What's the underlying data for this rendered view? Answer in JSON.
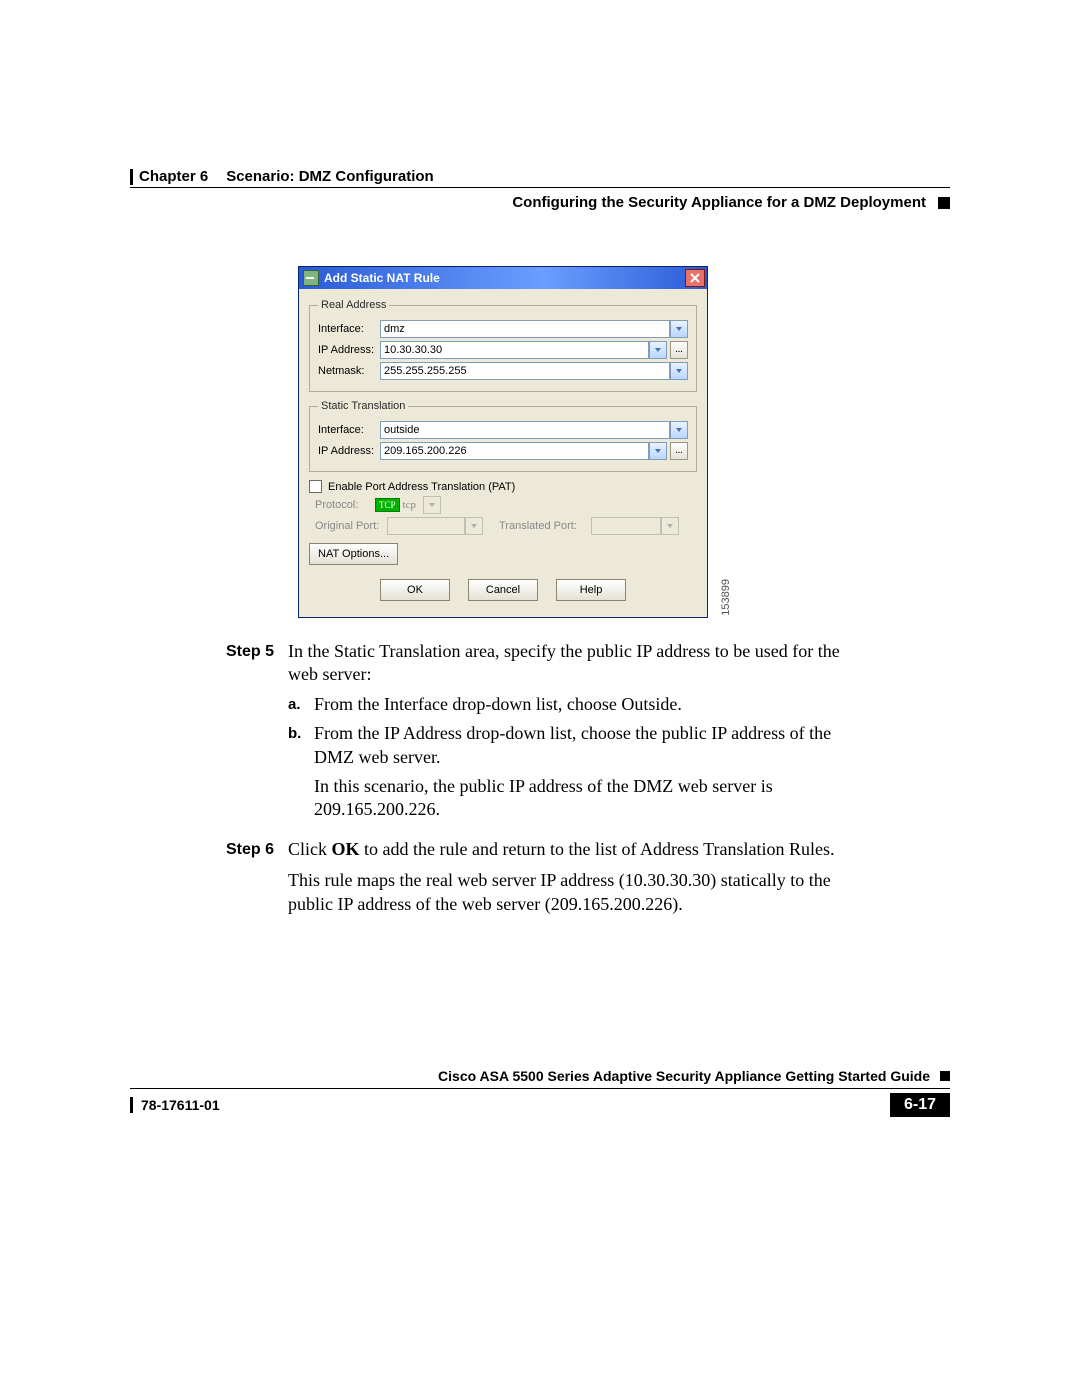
{
  "header": {
    "chapter": "Chapter 6",
    "chapter_title": "Scenario: DMZ Configuration",
    "section": "Configuring the Security Appliance for a DMZ Deployment"
  },
  "dialog": {
    "title": "Add Static NAT Rule",
    "fieldset_real": "Real Address",
    "fieldset_static": "Static Translation",
    "labels": {
      "interface": "Interface:",
      "ip": "IP Address:",
      "netmask": "Netmask:",
      "protocol": "Protocol:",
      "orig_port": "Original Port:",
      "trans_port": "Translated Port:"
    },
    "real": {
      "interface": "dmz",
      "ip": "10.30.30.30",
      "netmask": "255.255.255.255"
    },
    "static": {
      "interface": "outside",
      "ip": "209.165.200.226"
    },
    "pat": {
      "checkbox_label": "Enable Port Address Translation (PAT)",
      "protocol_badge": "TCP",
      "protocol_text": "tcp"
    },
    "buttons": {
      "nat_options": "NAT Options...",
      "ok": "OK",
      "cancel": "Cancel",
      "help": "Help"
    },
    "figure_id": "153899"
  },
  "steps": {
    "s5_label": "Step 5",
    "s5_intro": "In the Static Translation area, specify the public IP address to be used for the web server:",
    "s5a_letter": "a.",
    "s5a_text": "From the Interface drop-down list, choose Outside.",
    "s5b_letter": "b.",
    "s5b_text": "From the IP Address drop-down list, choose the public IP address of the DMZ web server.",
    "s5b_para": "In this scenario, the public IP address of the DMZ web server is 209.165.200.226.",
    "s6_label": "Step 6",
    "s6_click": "Click ",
    "s6_ok": "OK",
    "s6_rest": " to add the rule and return to the list of Address Translation Rules.",
    "s6_para": "This rule maps the real web server IP address (10.30.30.30) statically to the public IP address of the web server (209.165.200.226)."
  },
  "footer": {
    "guide": "Cisco ASA 5500 Series Adaptive Security Appliance Getting Started Guide",
    "docnum": "78-17611-01",
    "pagenum": "6-17"
  }
}
